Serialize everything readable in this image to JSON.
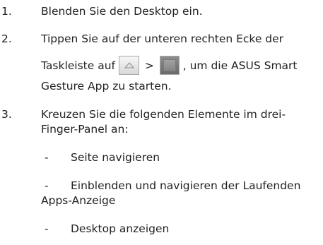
{
  "steps": [
    {
      "num": "1.",
      "text": "Blenden Sie den Desktop ein."
    },
    {
      "num": "2.",
      "line1": "Tippen Sie auf der unteren rechten Ecke der",
      "line2_before": "Taskleiste auf",
      "separator": ">",
      "line2_after": ", um die ASUS Smart",
      "line3": "Gesture App zu starten."
    },
    {
      "num": "3.",
      "line1": "Kreuzen Sie die folgenden Elemente im drei-",
      "line2": "Finger-Panel an:"
    }
  ],
  "bullets": [
    {
      "dash": "-",
      "text": "Seite navigieren"
    },
    {
      "dash": "-",
      "text": "Einblenden und navigieren der Laufenden",
      "cont": "Apps-Anzeige"
    },
    {
      "dash": "-",
      "text": "Desktop anzeigen"
    }
  ],
  "icons": {
    "taskbar_button": "arrow-up-icon",
    "app_button": "asus-smart-gesture-icon"
  }
}
